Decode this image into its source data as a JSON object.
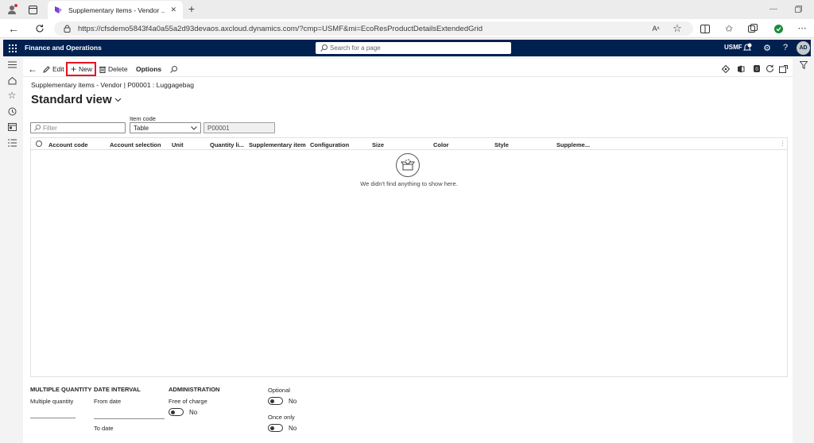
{
  "browser": {
    "tab_title": "Supplementary items - Vendor ...",
    "url": "https://cfsdemo5843f4a0a55a2d93devaos.axcloud.dynamics.com/?cmp=USMF&mi=EcoResProductDetailsExtendedGrid"
  },
  "topnav": {
    "app_name": "Finance and Operations",
    "search_placeholder": "Search for a page",
    "company": "USMF",
    "user_initials": "AD",
    "help": "?"
  },
  "actions": {
    "edit": "Edit",
    "new": "New",
    "delete": "Delete",
    "options": "Options"
  },
  "page": {
    "breadcrumb": "Supplementary items - Vendor   |  P00001 : Luggagebag",
    "view_name": "Standard view"
  },
  "filters": {
    "filter_placeholder": "Filter",
    "item_code_label": "Item code",
    "item_code_value": "Table",
    "item_number": "P00001"
  },
  "grid": {
    "columns": [
      "Account code",
      "Account selection",
      "Unit",
      "Quantity li...",
      "Supplementary item",
      "Configuration",
      "Size",
      "Color",
      "Style",
      "Suppleme..."
    ],
    "empty_message": "We didn't find anything to show here."
  },
  "details": {
    "multiple_quantity": {
      "title": "MULTIPLE QUANTITY",
      "field": "Multiple quantity"
    },
    "date_interval": {
      "title": "DATE INTERVAL",
      "from": "From date",
      "to": "To date"
    },
    "administration": {
      "title": "ADMINISTRATION",
      "free_of_charge": "Free of charge",
      "free_of_charge_value": "No"
    },
    "optional": {
      "label": "Optional",
      "value": "No"
    },
    "once_only": {
      "label": "Once only",
      "value": "No"
    }
  },
  "colors": {
    "nav_bg": "#002050",
    "highlight": "#e81123"
  }
}
